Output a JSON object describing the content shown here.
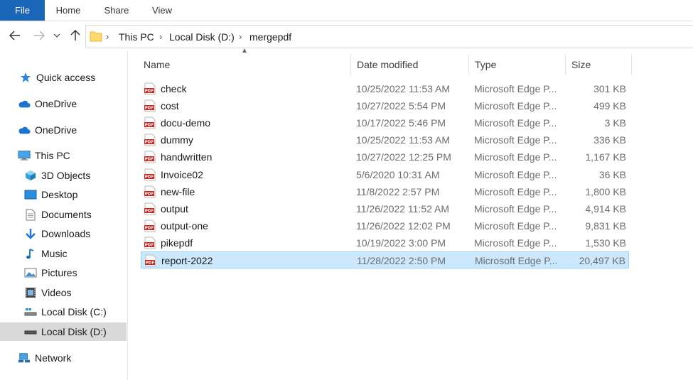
{
  "ribbon": {
    "tabs": [
      "File",
      "Home",
      "Share",
      "View"
    ]
  },
  "address": {
    "crumbs": [
      "This PC",
      "Local Disk (D:)",
      "mergepdf"
    ]
  },
  "sidebar": {
    "items": [
      {
        "label": "Quick access",
        "icon": "star-icon"
      },
      {
        "label": "OneDrive",
        "icon": "cloud-icon"
      },
      {
        "label": "OneDrive",
        "icon": "cloud-icon"
      },
      {
        "label": "This PC",
        "icon": "computer-icon"
      },
      {
        "label": "3D Objects",
        "icon": "cube-icon"
      },
      {
        "label": "Desktop",
        "icon": "desktop-icon"
      },
      {
        "label": "Documents",
        "icon": "document-icon"
      },
      {
        "label": "Downloads",
        "icon": "download-icon"
      },
      {
        "label": "Music",
        "icon": "music-icon"
      },
      {
        "label": "Pictures",
        "icon": "pictures-icon"
      },
      {
        "label": "Videos",
        "icon": "videos-icon"
      },
      {
        "label": "Local Disk (C:)",
        "icon": "drive-icon"
      },
      {
        "label": "Local Disk (D:)",
        "icon": "drive-icon"
      },
      {
        "label": "Network",
        "icon": "network-icon"
      }
    ]
  },
  "columns": {
    "name": "Name",
    "date": "Date modified",
    "type": "Type",
    "size": "Size"
  },
  "files": [
    {
      "name": "check",
      "date": "10/25/2022 11:53 AM",
      "type": "Microsoft Edge P...",
      "size": "301 KB"
    },
    {
      "name": "cost",
      "date": "10/27/2022 5:54 PM",
      "type": "Microsoft Edge P...",
      "size": "499 KB"
    },
    {
      "name": "docu-demo",
      "date": "10/17/2022 5:46 PM",
      "type": "Microsoft Edge P...",
      "size": "3 KB"
    },
    {
      "name": "dummy",
      "date": "10/25/2022 11:53 AM",
      "type": "Microsoft Edge P...",
      "size": "336 KB"
    },
    {
      "name": "handwritten",
      "date": "10/27/2022 12:25 PM",
      "type": "Microsoft Edge P...",
      "size": "1,167 KB"
    },
    {
      "name": "Invoice02",
      "date": "5/6/2020 10:31 AM",
      "type": "Microsoft Edge P...",
      "size": "36 KB"
    },
    {
      "name": "new-file",
      "date": "11/8/2022 2:57 PM",
      "type": "Microsoft Edge P...",
      "size": "1,800 KB"
    },
    {
      "name": "output",
      "date": "11/26/2022 11:52 AM",
      "type": "Microsoft Edge P...",
      "size": "4,914 KB"
    },
    {
      "name": "output-one",
      "date": "11/26/2022 12:02 PM",
      "type": "Microsoft Edge P...",
      "size": "9,831 KB"
    },
    {
      "name": "pikepdf",
      "date": "10/19/2022 3:00 PM",
      "type": "Microsoft Edge P...",
      "size": "1,530 KB"
    },
    {
      "name": "report-2022",
      "date": "11/28/2022 2:50 PM",
      "type": "Microsoft Edge P...",
      "size": "20,497 KB"
    }
  ],
  "colors": {
    "file_tab": "#1a66b8",
    "selection": "#cce8ff",
    "selection_border": "#99d1ff",
    "pdf_red": "#c4281c"
  }
}
